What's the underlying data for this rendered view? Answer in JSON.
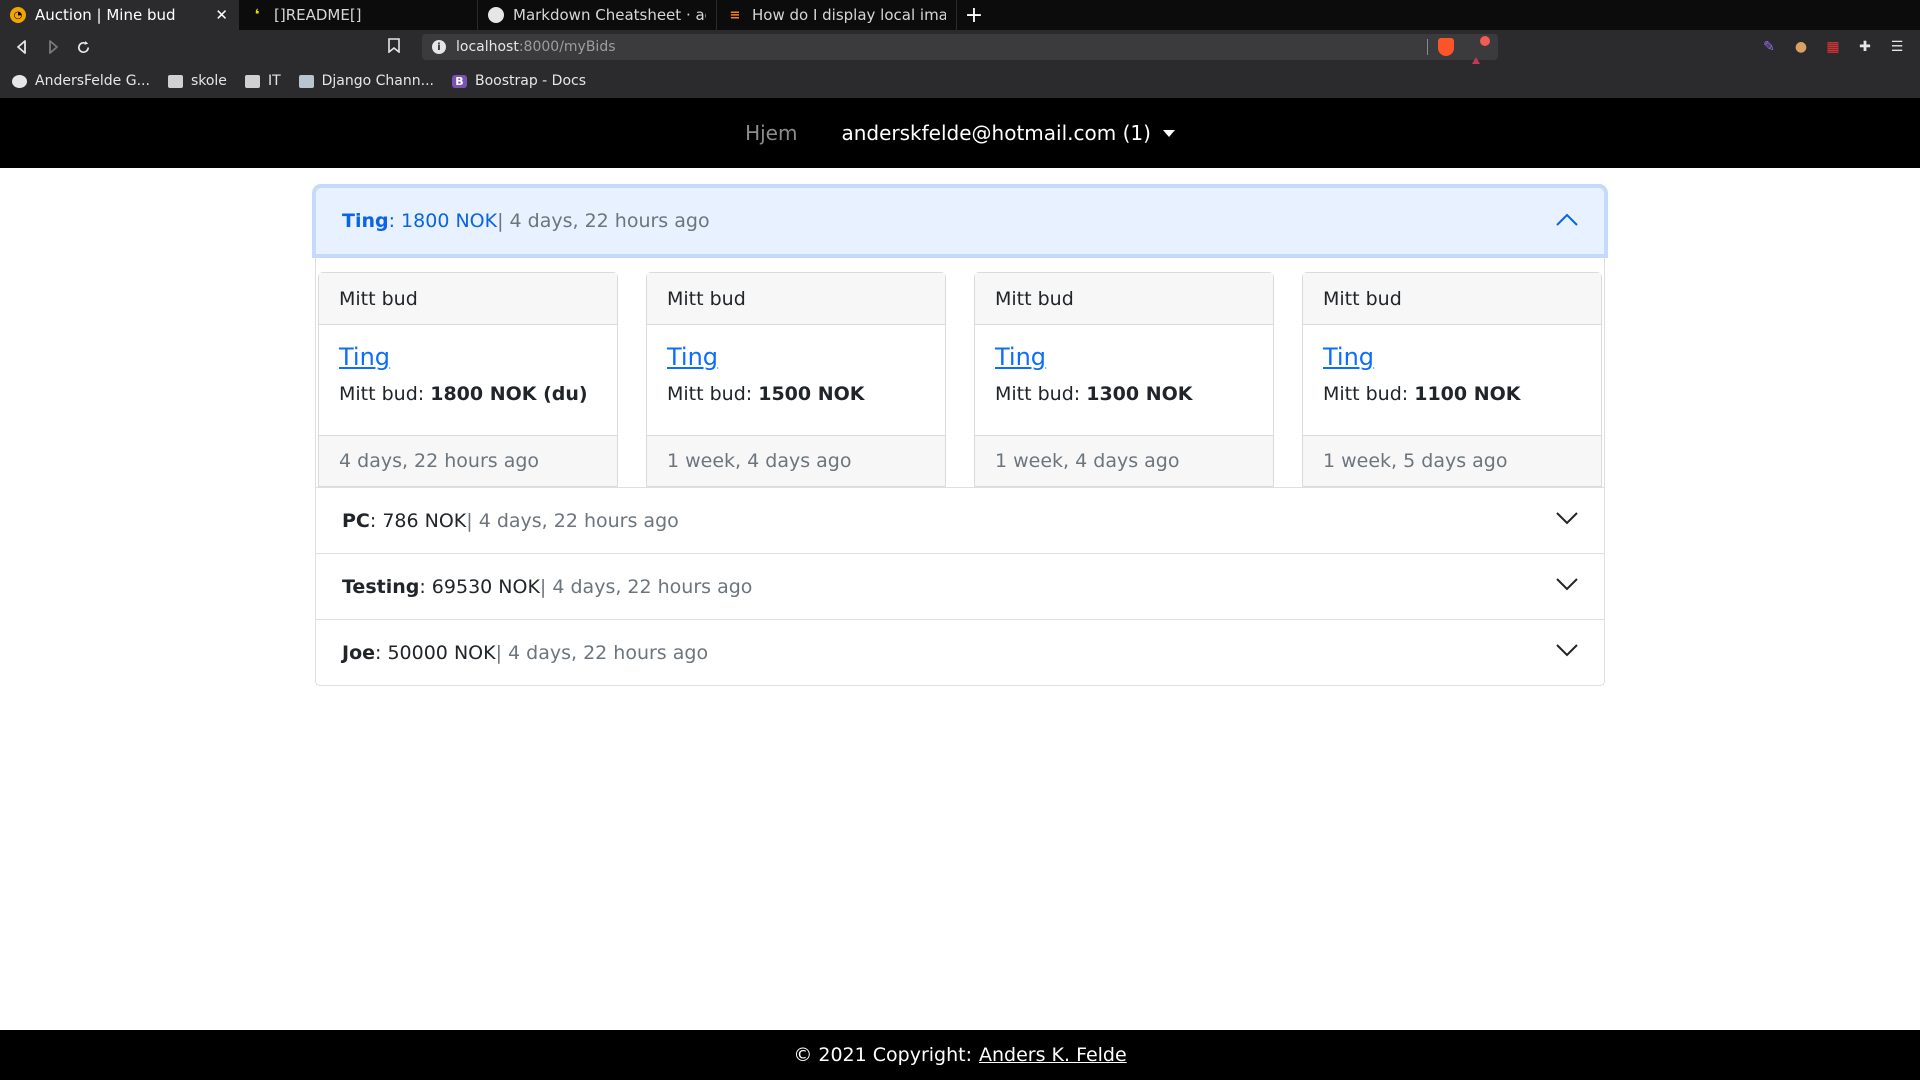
{
  "browser": {
    "tabs": [
      {
        "title": "Auction | Mine bud",
        "icon": "auction-favicon",
        "color": "#f0a500",
        "active": true
      },
      {
        "title": "[]README[]",
        "icon": "readme-favicon",
        "color": "#e8e000",
        "active": false
      },
      {
        "title": "Markdown Cheatsheet · adam",
        "icon": "github-favicon",
        "color": "#e6e6e6",
        "active": false
      },
      {
        "title": "How do I display local image i",
        "icon": "stackoverflow-favicon",
        "color": "#f48024",
        "active": false
      }
    ],
    "close_glyph": "✕",
    "new_tab_glyph": "+",
    "url_host": "localhost",
    "url_path": ":8000/myBids",
    "bookmarks": [
      {
        "label": "AndersFelde G...",
        "icon": "github-icon"
      },
      {
        "label": "skole",
        "icon": "folder-icon"
      },
      {
        "label": "IT",
        "icon": "folder-icon"
      },
      {
        "label": "Django Chann...",
        "icon": "docs-icon"
      },
      {
        "label": "Boostrap - Docs",
        "icon": "bootstrap-icon",
        "glyph": "B"
      }
    ]
  },
  "nav": {
    "home": "Hjem",
    "user": "anderskfelde@hotmail.com (1)"
  },
  "accordion": {
    "items": [
      {
        "name": "Ting",
        "price": ": 1800 NOK",
        "time": "| 4 days, 22 hours ago",
        "open": true
      },
      {
        "name": "PC",
        "price": ": 786 NOK",
        "time": "| 4 days, 22 hours ago",
        "open": false
      },
      {
        "name": "Testing",
        "price": ": 69530 NOK",
        "time": "| 4 days, 22 hours ago",
        "open": false
      },
      {
        "name": "Joe",
        "price": ": 50000 NOK",
        "time": "| 4 days, 22 hours ago",
        "open": false
      }
    ],
    "cards": [
      {
        "header": "Mitt bud",
        "link": "Ting",
        "label": "Mitt bud: ",
        "amount": "1800 NOK (du)",
        "footer": "4 days, 22 hours ago"
      },
      {
        "header": "Mitt bud",
        "link": "Ting",
        "label": "Mitt bud: ",
        "amount": "1500 NOK",
        "footer": "1 week, 4 days ago"
      },
      {
        "header": "Mitt bud",
        "link": "Ting",
        "label": "Mitt bud: ",
        "amount": "1300 NOK",
        "footer": "1 week, 4 days ago"
      },
      {
        "header": "Mitt bud",
        "link": "Ting",
        "label": "Mitt bud: ",
        "amount": "1100 NOK",
        "footer": "1 week, 5 days ago"
      }
    ]
  },
  "footer": {
    "text": "© 2021 Copyright:",
    "link": "Anders K. Felde"
  },
  "colors": {
    "accent": "#0c63e4",
    "link": "#0d6efd",
    "muted": "#6c757d",
    "nav_bg": "#000000"
  }
}
